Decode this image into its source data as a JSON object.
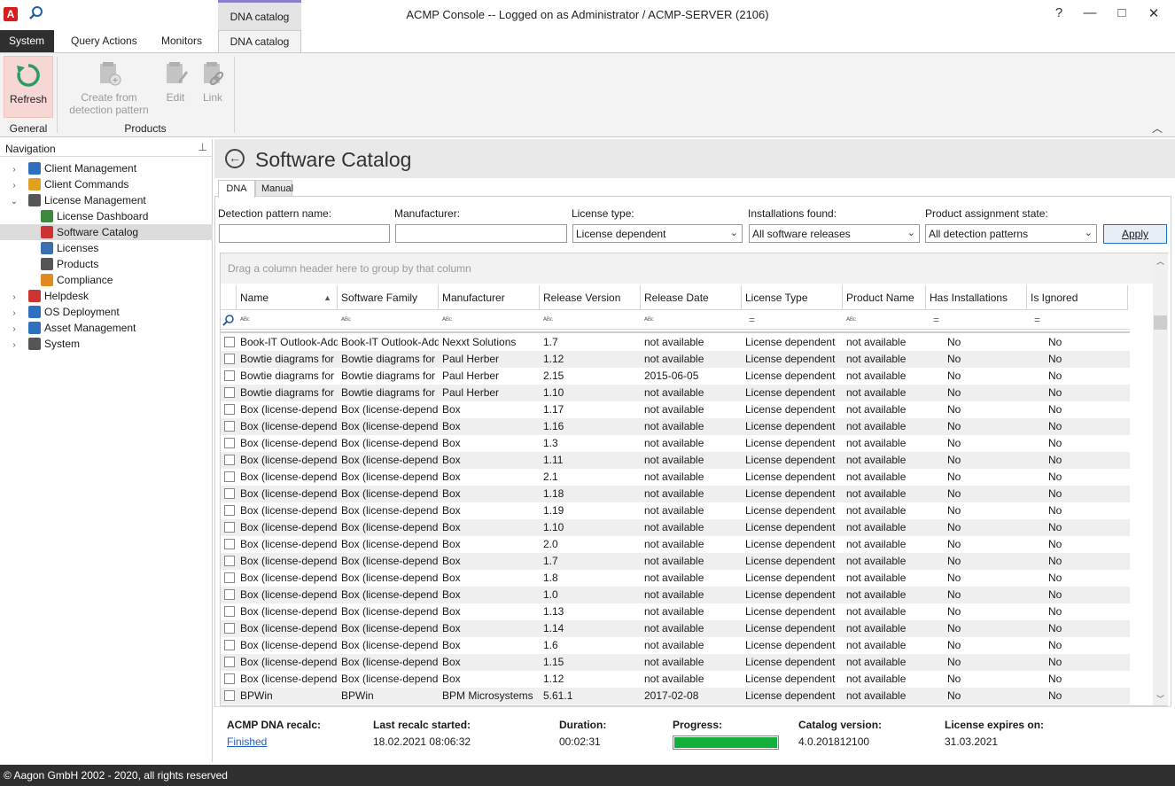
{
  "window": {
    "title": "ACMP Console -- Logged on as Administrator / ACMP-SERVER (2106)",
    "context_tab": "DNA catalog",
    "app_logo": "A",
    "help": "?",
    "minimize": "—",
    "maximize": "□",
    "close": "✕"
  },
  "ribbon_tabs": [
    "System",
    "Query Actions",
    "Monitors",
    "DNA catalog"
  ],
  "ribbon": {
    "groups": [
      "General",
      "Products"
    ],
    "refresh": "Refresh",
    "create_line1": "Create from",
    "create_line2": "detection pattern",
    "edit": "Edit",
    "link": "Link",
    "collapse": "︿"
  },
  "nav": {
    "header": "Navigation",
    "items": [
      {
        "label": "Client Management",
        "level": 0,
        "expander": "›",
        "icon": "client-management-icon"
      },
      {
        "label": "Client Commands",
        "level": 0,
        "expander": "›",
        "icon": "client-commands-icon"
      },
      {
        "label": "License Management",
        "level": 0,
        "expander": "⌄",
        "icon": "license-management-icon"
      },
      {
        "label": "License Dashboard",
        "level": 1,
        "expander": "",
        "icon": "license-dashboard-icon"
      },
      {
        "label": "Software Catalog",
        "level": 1,
        "expander": "",
        "icon": "software-catalog-icon"
      },
      {
        "label": "Licenses",
        "level": 1,
        "expander": "",
        "icon": "licenses-icon"
      },
      {
        "label": "Products",
        "level": 1,
        "expander": "",
        "icon": "products-icon"
      },
      {
        "label": "Compliance",
        "level": 1,
        "expander": "",
        "icon": "compliance-icon"
      },
      {
        "label": "Helpdesk",
        "level": 0,
        "expander": "›",
        "icon": "helpdesk-icon"
      },
      {
        "label": "OS Deployment",
        "level": 0,
        "expander": "›",
        "icon": "os-deployment-icon"
      },
      {
        "label": "Asset Management",
        "level": 0,
        "expander": "›",
        "icon": "asset-management-icon"
      },
      {
        "label": "System",
        "level": 0,
        "expander": "›",
        "icon": "system-icon"
      }
    ]
  },
  "page": {
    "title": "Software Catalog",
    "back": "←",
    "tabs": [
      "DNA",
      "Manual"
    ]
  },
  "filters": {
    "detection_label": "Detection pattern name:",
    "manufacturer_label": "Manufacturer:",
    "license_type_label": "License type:",
    "license_type_value": "License dependent",
    "installations_label": "Installations found:",
    "installations_value": "All software releases",
    "assignment_label": "Product assignment state:",
    "assignment_value": "All detection patterns",
    "apply": "Apply"
  },
  "grid": {
    "group_hint": "Drag a column header here to group by that column",
    "columns": [
      "Name",
      "Software Family",
      "Manufacturer",
      "Release Version",
      "Release Date",
      "License Type",
      "Product Name",
      "Has Installations",
      "Is Ignored"
    ],
    "filter_glyph": "ᴬᴮᶜ",
    "filter_eq": "=",
    "rows": [
      [
        "Book-IT Outlook-Addin",
        "Book-IT Outlook-Addin",
        "Nexxt Solutions",
        "1.7",
        "not available",
        "License dependent",
        "not available",
        "No",
        "No"
      ],
      [
        "Bowtie diagrams for ...",
        "Bowtie diagrams for ...",
        "Paul Herber",
        "1.12",
        "not available",
        "License dependent",
        "not available",
        "No",
        "No"
      ],
      [
        "Bowtie diagrams for ...",
        "Bowtie diagrams for ...",
        "Paul Herber",
        "2.15",
        "2015-06-05",
        "License dependent",
        "not available",
        "No",
        "No"
      ],
      [
        "Bowtie diagrams for ...",
        "Bowtie diagrams for ...",
        "Paul Herber",
        "1.10",
        "not available",
        "License dependent",
        "not available",
        "No",
        "No"
      ],
      [
        "Box (license-depend...",
        "Box (license-depend...",
        "Box",
        "1.17",
        "not available",
        "License dependent",
        "not available",
        "No",
        "No"
      ],
      [
        "Box (license-depend...",
        "Box (license-depend...",
        "Box",
        "1.16",
        "not available",
        "License dependent",
        "not available",
        "No",
        "No"
      ],
      [
        "Box (license-depend...",
        "Box (license-depend...",
        "Box",
        "1.3",
        "not available",
        "License dependent",
        "not available",
        "No",
        "No"
      ],
      [
        "Box (license-depend...",
        "Box (license-depend...",
        "Box",
        "1.11",
        "not available",
        "License dependent",
        "not available",
        "No",
        "No"
      ],
      [
        "Box (license-depend...",
        "Box (license-depend...",
        "Box",
        "2.1",
        "not available",
        "License dependent",
        "not available",
        "No",
        "No"
      ],
      [
        "Box (license-depend...",
        "Box (license-depend...",
        "Box",
        "1.18",
        "not available",
        "License dependent",
        "not available",
        "No",
        "No"
      ],
      [
        "Box (license-depend...",
        "Box (license-depend...",
        "Box",
        "1.19",
        "not available",
        "License dependent",
        "not available",
        "No",
        "No"
      ],
      [
        "Box (license-depend...",
        "Box (license-depend...",
        "Box",
        "1.10",
        "not available",
        "License dependent",
        "not available",
        "No",
        "No"
      ],
      [
        "Box (license-depend...",
        "Box (license-depend...",
        "Box",
        "2.0",
        "not available",
        "License dependent",
        "not available",
        "No",
        "No"
      ],
      [
        "Box (license-depend...",
        "Box (license-depend...",
        "Box",
        "1.7",
        "not available",
        "License dependent",
        "not available",
        "No",
        "No"
      ],
      [
        "Box (license-depend...",
        "Box (license-depend...",
        "Box",
        "1.8",
        "not available",
        "License dependent",
        "not available",
        "No",
        "No"
      ],
      [
        "Box (license-depend...",
        "Box (license-depend...",
        "Box",
        "1.0",
        "not available",
        "License dependent",
        "not available",
        "No",
        "No"
      ],
      [
        "Box (license-depend...",
        "Box (license-depend...",
        "Box",
        "1.13",
        "not available",
        "License dependent",
        "not available",
        "No",
        "No"
      ],
      [
        "Box (license-depend...",
        "Box (license-depend...",
        "Box",
        "1.14",
        "not available",
        "License dependent",
        "not available",
        "No",
        "No"
      ],
      [
        "Box (license-depend...",
        "Box (license-depend...",
        "Box",
        "1.6",
        "not available",
        "License dependent",
        "not available",
        "No",
        "No"
      ],
      [
        "Box (license-depend...",
        "Box (license-depend...",
        "Box",
        "1.15",
        "not available",
        "License dependent",
        "not available",
        "No",
        "No"
      ],
      [
        "Box (license-depend...",
        "Box (license-depend...",
        "Box",
        "1.12",
        "not available",
        "License dependent",
        "not available",
        "No",
        "No"
      ],
      [
        "BPWin",
        "BPWin",
        "BPM Microsystems",
        "5.61.1",
        "2017-02-08",
        "License dependent",
        "not available",
        "No",
        "No"
      ]
    ]
  },
  "status": {
    "recalc_label": "ACMP DNA recalc:",
    "recalc_value": "Finished",
    "started_label": "Last recalc started:",
    "started_value": "18.02.2021 08:06:32",
    "duration_label": "Duration:",
    "duration_value": "00:02:31",
    "progress_label": "Progress:",
    "progress_fraction": 1.0,
    "catalog_label": "Catalog version:",
    "catalog_value": "4.0.201812100",
    "expires_label": "License expires on:",
    "expires_value": "31.03.2021"
  },
  "footer": "© Aagon GmbH 2002 - 2020, all rights reserved"
}
